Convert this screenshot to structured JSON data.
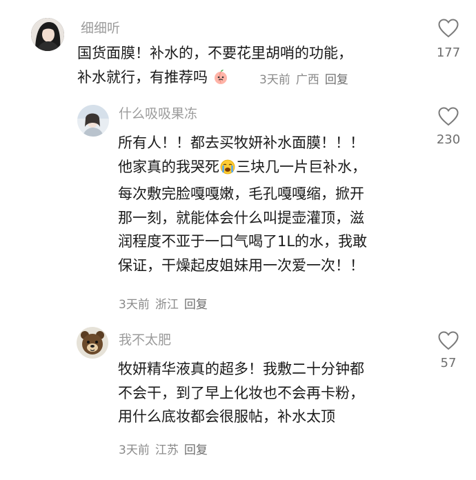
{
  "comments": [
    {
      "username": "细细听",
      "lines": [
        "国货面膜！补水的，不要花里胡哨的功能，",
        "补水就行，有推荐吗"
      ],
      "time": "3天前",
      "location": "广西",
      "reply_label": "回复",
      "likes": "177",
      "emoji": "peach-emoji"
    },
    {
      "username": "什么吸吸果冻",
      "lines": [
        "所有人！！都去买牧妍补水面膜！！！",
        "他家真的我哭死",
        "三块几一片巨补水，",
        "每次敷完脸嘎嘎嫩，毛孔嘎嘎缩，掀开",
        "那一刻，就能体会什么叫提壶灌顶，滋",
        "润程度不亚于一口气喝了1L的水，我敢",
        "保证，干燥起皮姐妹用一次爱一次！！"
      ],
      "time": "3天前",
      "location": "浙江",
      "reply_label": "回复",
      "likes": "230",
      "emoji": "crying-face-emoji"
    },
    {
      "username": "我不太肥",
      "lines": [
        "牧妍精华液真的超多！我敷二十分钟都",
        "不会干，到了早上化妆也不会再卡粉，",
        "用什么底妆都会很服帖，补水太顶"
      ],
      "time": "3天前",
      "location": "江苏",
      "reply_label": "回复",
      "likes": "57"
    }
  ]
}
